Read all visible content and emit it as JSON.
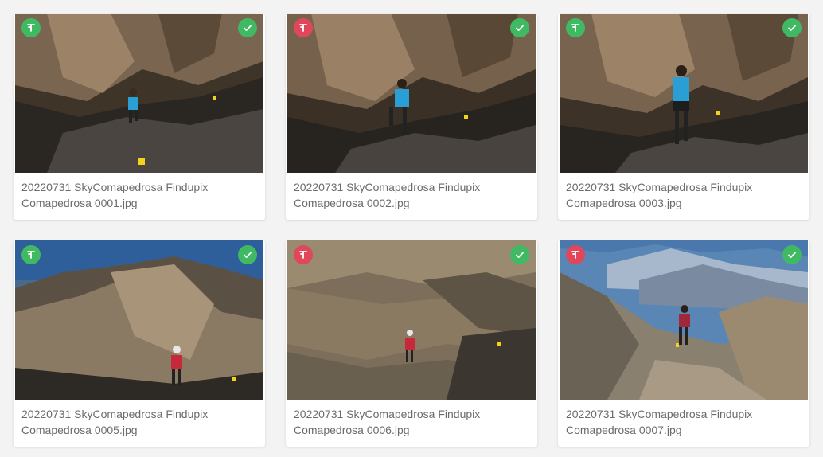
{
  "photos": [
    {
      "filename": "20220731 SkyComapedrosa Findupix Comapedrosa 0001.jpg",
      "tag_color": "#3fba63",
      "tag_icon": "tag-t-icon",
      "selected": true,
      "scene": "dark-rock"
    },
    {
      "filename": "20220731 SkyComapedrosa Findupix Comapedrosa 0002.jpg",
      "tag_color": "#e0475b",
      "tag_icon": "tag-t-icon",
      "selected": true,
      "scene": "dark-rock"
    },
    {
      "filename": "20220731 SkyComapedrosa Findupix Comapedrosa 0003.jpg",
      "tag_color": "#3fba63",
      "tag_icon": "tag-t-icon",
      "selected": true,
      "scene": "dark-rock"
    },
    {
      "filename": "20220731 SkyComapedrosa Findupix Comapedrosa 0005.jpg",
      "tag_color": "#3fba63",
      "tag_icon": "tag-t-icon",
      "selected": true,
      "scene": "sky-rock"
    },
    {
      "filename": "20220731 SkyComapedrosa Findupix Comapedrosa 0006.jpg",
      "tag_color": "#e0475b",
      "tag_icon": "tag-t-icon",
      "selected": true,
      "scene": "scree"
    },
    {
      "filename": "20220731 SkyComapedrosa Findupix Comapedrosa 0007.jpg",
      "tag_color": "#e0475b",
      "tag_icon": "tag-t-icon",
      "selected": true,
      "scene": "valley"
    }
  ],
  "colors": {
    "check_badge": "#3fba63",
    "runner_blue": "#2a9fd6",
    "runner_red": "#c7283a"
  }
}
